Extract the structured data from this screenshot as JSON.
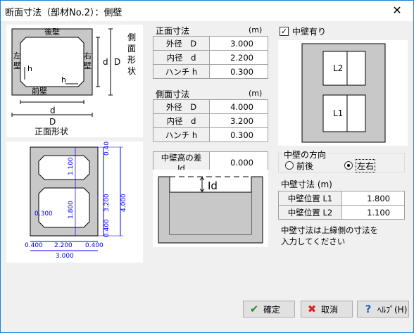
{
  "window": {
    "title": "断面寸法（部材No.2）：側壁",
    "close_glyph": "✕"
  },
  "front_diagram": {
    "back_wall": "後壁",
    "left_wall": "左\n壁",
    "right_wall": "右\n壁",
    "front_wall": "前壁",
    "h": "h",
    "d": "d",
    "D": "D",
    "side_shape": "側\n面\n形\n状",
    "front_shape": "正面形状"
  },
  "front_dims": {
    "title": "正面寸法",
    "unit": "(m)",
    "rows": [
      {
        "label": "外径　D",
        "value": "3.000"
      },
      {
        "label": "内径　d",
        "value": "2.200"
      },
      {
        "label": "ハンチ h",
        "value": "0.300"
      }
    ]
  },
  "side_dims": {
    "title": "側面寸法",
    "unit": "(m)",
    "rows": [
      {
        "label": "外径　D",
        "value": "4.000"
      },
      {
        "label": "内径　d",
        "value": "3.200"
      },
      {
        "label": "ハンチ h",
        "value": "0.300"
      }
    ]
  },
  "height_diff": {
    "label": "中壁高の差 Id",
    "value": "0.000",
    "diagram_label": "Id"
  },
  "middle_wall": {
    "checkbox_label": "中壁有り",
    "checked": true,
    "L1": "L1",
    "L2": "L2"
  },
  "direction": {
    "title": "中壁の方向",
    "options": [
      "前後",
      "左右"
    ],
    "selected": 1
  },
  "mw_dims": {
    "title": "中壁寸法 (m)",
    "rows": [
      {
        "label": "中壁位置 L1",
        "value": "1.800"
      },
      {
        "label": "中壁位置 L2",
        "value": "1.100"
      }
    ],
    "note_line1": "中壁寸法は上縁側の寸法を",
    "note_line2": "入力してください"
  },
  "cad": {
    "top": "0.400",
    "upper_inner": "1.100",
    "lower_inner": "1.800",
    "mid_top": "0.400",
    "bottom": "0.400",
    "inner_h": "3.200",
    "outer_h": "4.000",
    "left_label": "0.300",
    "w_left": "0.400",
    "w_inner": "2.200",
    "w_right": "0.400",
    "w_total": "3.000"
  },
  "buttons": {
    "ok": "確定",
    "cancel": "取消",
    "help": "ﾍﾙﾌﾟ(H)"
  }
}
